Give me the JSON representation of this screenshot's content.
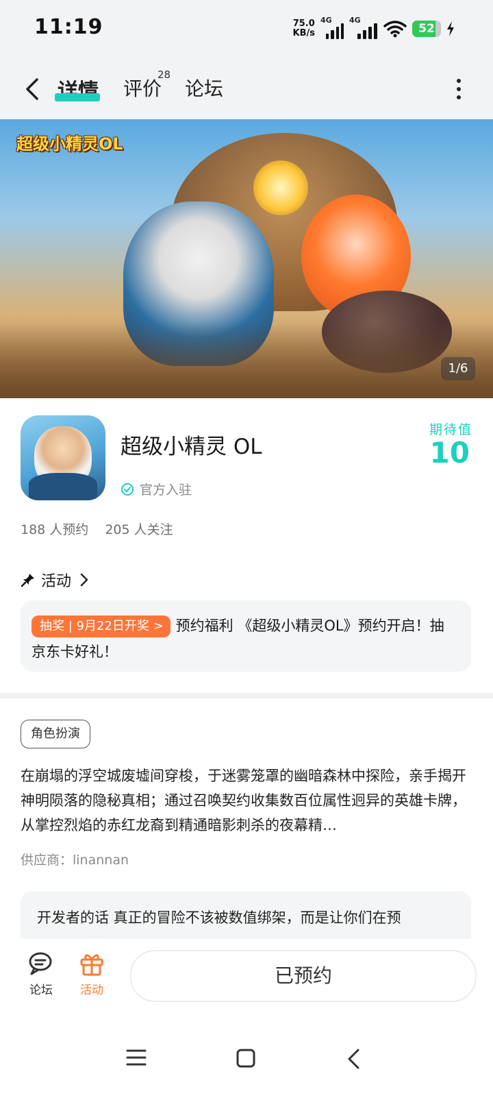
{
  "status_bar": {
    "time": "11:19",
    "net_speed_value": "75.0",
    "net_speed_unit": "KB/s",
    "sim1_label": "4G",
    "sim2_label": "4G",
    "battery_level": "52"
  },
  "nav": {
    "tabs": [
      {
        "label": "详情"
      },
      {
        "label": "评价",
        "count": "28"
      },
      {
        "label": "论坛"
      }
    ]
  },
  "banner": {
    "logo_text": "超级小精灵OL",
    "counter": "1/6"
  },
  "app": {
    "title": "超级小精灵 OL",
    "official_label": "官方入驻",
    "expect_label": "期待值",
    "expect_value": "10",
    "reservations": "188 人预约",
    "followers": "205 人关注"
  },
  "activity": {
    "heading": "活动",
    "tag": "抽奖 | 9月22日开奖 >",
    "text": "预约福利 《超级小精灵OL》预约开启！抽京东卡好礼！"
  },
  "details": {
    "genre_tag": "角色扮演",
    "description": "在崩塌的浮空城废墟间穿梭，于迷雾笼罩的幽暗森林中探险，亲手揭开神明陨落的隐秘真相；通过召唤契约收集数百位属性迥异的英雄卡牌，从掌控烈焰的赤红龙裔到精通暗影刺杀的夜幕精…",
    "supplier": "供应商：linannan",
    "dev_words": "开发者的话  真正的冒险不该被数值绑架，而是让你们在预"
  },
  "bottom_bar": {
    "forum_label": "论坛",
    "activity_label": "活动",
    "reserve_label": "已预约"
  },
  "colors": {
    "accent": "#1ecfc0",
    "orange": "#ff7438",
    "battery_green": "#34c759"
  }
}
